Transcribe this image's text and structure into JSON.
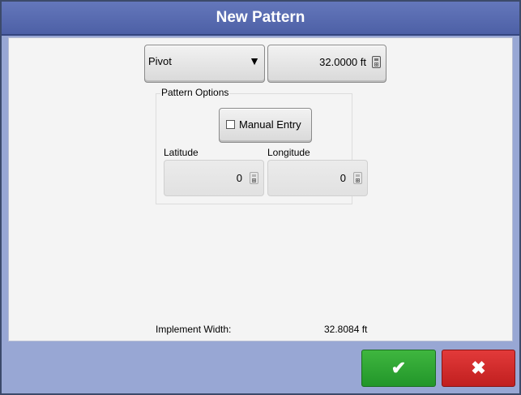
{
  "window": {
    "title": "New Pattern"
  },
  "pattern_type": {
    "selected": "Pivot",
    "arrow": "▼"
  },
  "width_field": {
    "value": "32.0000 ft"
  },
  "pattern_options": {
    "group_label": "Pattern Options",
    "manual_entry_label": "Manual Entry",
    "manual_entry_checked": false,
    "latitude_label": "Latitude",
    "latitude_value": "0",
    "longitude_label": "Longitude",
    "longitude_value": "0"
  },
  "implement": {
    "label": "Implement Width:",
    "value": "32.8084 ft"
  },
  "actions": {
    "ok_glyph": "✔",
    "cancel_glyph": "✖",
    "ok_color": "#2aa534",
    "cancel_color": "#d12a2a"
  },
  "icons": {
    "calculator": "calculator-icon",
    "dropdown": "dropdown-arrow-icon",
    "checkbox": "checkbox-icon"
  }
}
